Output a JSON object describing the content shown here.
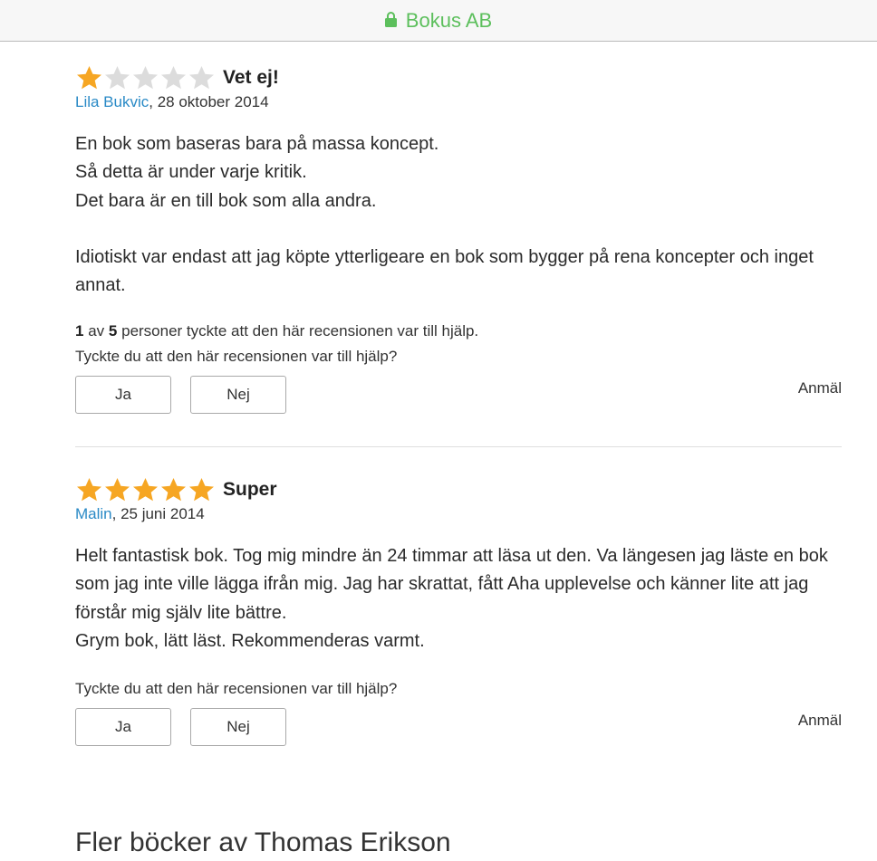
{
  "header": {
    "site_name": "Bokus AB",
    "secure_icon": "lock-icon",
    "accent_color": "#5cbf5c"
  },
  "reviews": [
    {
      "rating": 1,
      "max_rating": 5,
      "title": "Vet ej!",
      "author": "Lila Bukvic",
      "date": ", 28 oktober 2014",
      "body": [
        "En bok som baseras bara på massa koncept.",
        "Så detta är under varje kritik.",
        "Det bara är en till bok som alla andra.",
        "",
        "Idiotiskt var endast att jag köpte ytterligeare en bok som bygger på rena koncepter och inget annat."
      ],
      "helpful_count": "1",
      "helpful_av": "av",
      "helpful_total": "5",
      "helpful_suffix": "personer tyckte att den här recensionen var till hjälp.",
      "question": "Tyckte du att den här recensionen var till hjälp?",
      "yes_label": "Ja",
      "no_label": "Nej",
      "report_label": "Anmäl"
    },
    {
      "rating": 5,
      "max_rating": 5,
      "title": "Super",
      "author": "Malin",
      "date": ", 25 juni 2014",
      "body": [
        "Helt fantastisk bok. Tog mig mindre än 24 timmar att läsa ut den. Va längesen jag läste en bok som jag inte ville lägga ifrån mig. Jag har skrattat, fått Aha upplevelse och känner lite att jag förstår mig själv lite bättre.",
        "Grym bok, lätt läst. Rekommenderas varmt."
      ],
      "question": "Tyckte du att den här recensionen var till hjälp?",
      "yes_label": "Ja",
      "no_label": "Nej",
      "report_label": "Anmäl"
    }
  ],
  "more_books": {
    "title": "Fler böcker av Thomas Erikson"
  },
  "colors": {
    "star_filled": "#f6a623",
    "star_empty": "#dcdcdc",
    "link": "#2a8ac6"
  }
}
